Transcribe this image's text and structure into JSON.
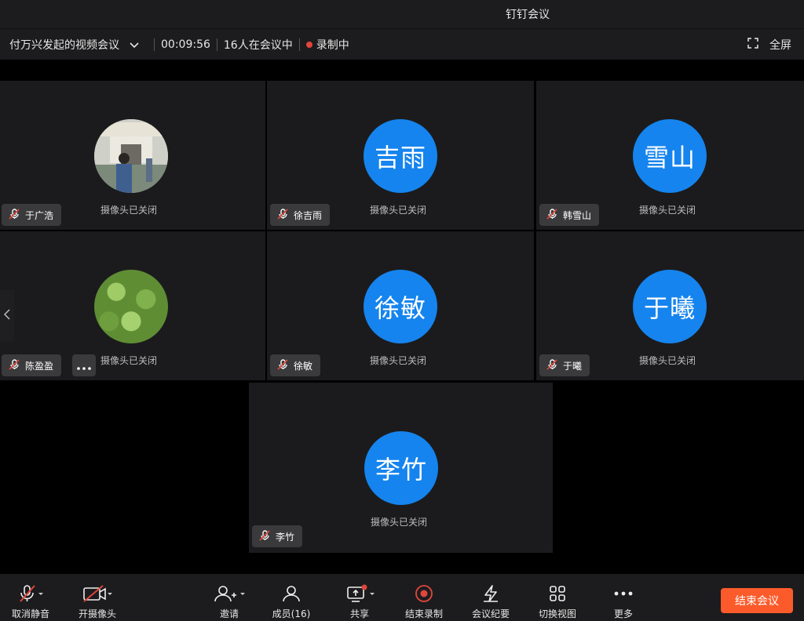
{
  "window": {
    "title": "钉钉会议"
  },
  "infobar": {
    "meeting_name": "付万兴发起的视频会议",
    "duration": "00:09:56",
    "participants": "16人在会议中",
    "recording": "录制中",
    "fullscreen": "全屏"
  },
  "tiles": [
    {
      "name": "于广浩",
      "avatar_text": "",
      "camera_status": "摄像头已关闭"
    },
    {
      "name": "徐吉雨",
      "avatar_text": "吉雨",
      "camera_status": "摄像头已关闭"
    },
    {
      "name": "韩雪山",
      "avatar_text": "雪山",
      "camera_status": "摄像头已关闭"
    },
    {
      "name": "陈盈盈",
      "avatar_text": "",
      "camera_status": "摄像头已关闭"
    },
    {
      "name": "徐敏",
      "avatar_text": "徐敏",
      "camera_status": "摄像头已关闭"
    },
    {
      "name": "于曦",
      "avatar_text": "于曦",
      "camera_status": "摄像头已关闭"
    },
    {
      "name": "李竹",
      "avatar_text": "李竹",
      "camera_status": "摄像头已关闭"
    }
  ],
  "toolbar": {
    "unmute": "取消静音",
    "camera": "开摄像头",
    "invite": "邀请",
    "members": "成员(16)",
    "share": "共享",
    "stop_recording": "结束录制",
    "minutes": "会议纪要",
    "switch_view": "切换视图",
    "more": "更多",
    "end_meeting": "结束会议"
  },
  "colors": {
    "avatar": "#1584ee",
    "end_button": "#fb5b2b",
    "record_red": "#e0463b"
  }
}
